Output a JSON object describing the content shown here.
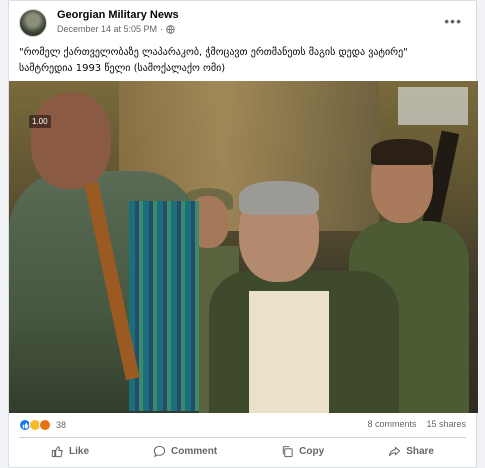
{
  "post": {
    "author": "Georgian Military News",
    "date": "December 14 at 5:05 PM",
    "separator": "·",
    "more": "•••",
    "caption_line1": "\"რომელ ქართველობაზე ლაპარაკობ, ჭმოცავთ ერთმანეთს მაგის დედა ვატირე\"",
    "caption_line2": "სამტრედია 1993 წელი (სამოქალაქო ომი)"
  },
  "video": {
    "timestamp": "1.00"
  },
  "stats": {
    "reaction_count": "38",
    "comments": "8 comments",
    "shares": "15 shares"
  },
  "actions": {
    "like": "Like",
    "comment": "Comment",
    "copy": "Copy",
    "share": "Share"
  },
  "icons": {
    "privacy": "globe-icon",
    "like": "thumbs-up-icon",
    "comment": "speech-bubble-icon",
    "copy": "copy-icon",
    "share": "share-arrow-icon"
  },
  "colors": {
    "like_blue": "#1877f2",
    "care_yellow": "#f7b928",
    "angry_orange": "#e9710f",
    "muted_text": "#65676b"
  }
}
